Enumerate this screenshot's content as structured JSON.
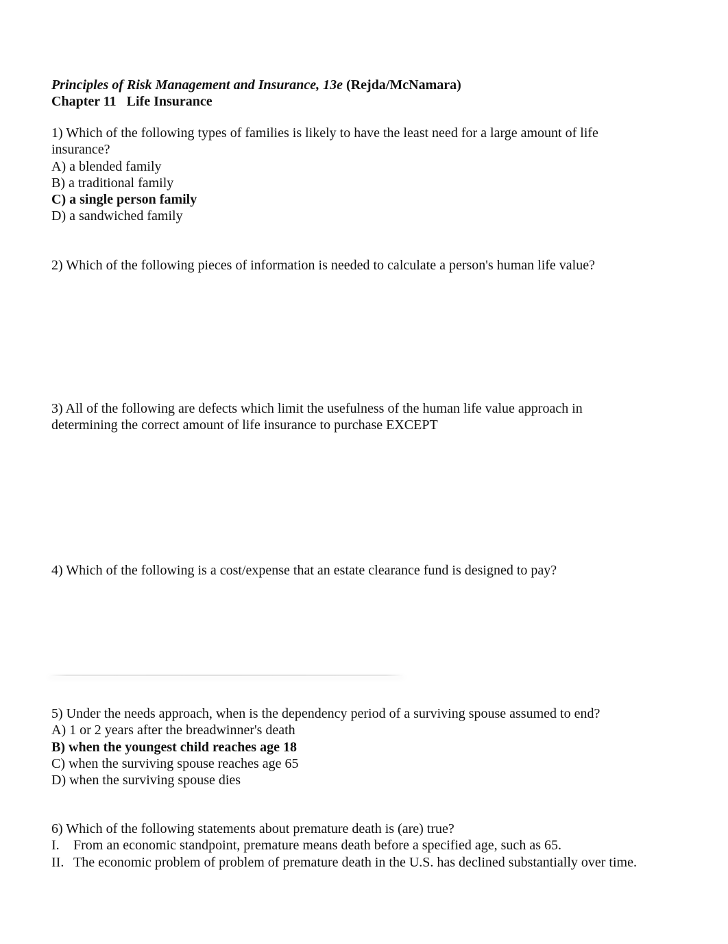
{
  "header": {
    "book_title": "Principles of Risk Management and Insurance, 13e",
    "authors": "(Rejda/McNamara)",
    "chapter": "Chapter 11   Life Insurance"
  },
  "questions": [
    {
      "text": "1) Which of the following types of families is likely to have the least need for a large amount of life insurance?",
      "options": [
        {
          "label": "A) a blended family",
          "correct": false
        },
        {
          "label": "B) a traditional family",
          "correct": false
        },
        {
          "label": "C) a single person family",
          "correct": true
        },
        {
          "label": "D) a sandwiched family",
          "correct": false
        }
      ]
    },
    {
      "text": "2) Which of the following pieces of information is needed to calculate a person's human life value?"
    },
    {
      "text": "3) All of the following are defects which limit the usefulness of the human life value approach in determining the correct amount of life insurance to purchase EXCEPT"
    },
    {
      "text": "4) Which of the following is a cost/expense that an estate clearance fund is designed to pay?"
    },
    {
      "text": "5) Under the needs approach, when is the dependency period of a surviving spouse assumed to end?",
      "options": [
        {
          "label": "A) 1 or 2 years after the breadwinner's death",
          "correct": false
        },
        {
          "label": "B) when the youngest child reaches age 18",
          "correct": true
        },
        {
          "label": "C) when the surviving spouse reaches age 65",
          "correct": false
        },
        {
          "label": "D) when the surviving spouse dies",
          "correct": false
        }
      ]
    },
    {
      "text": "6) Which of the following statements about premature death is (are) true?",
      "statements": [
        {
          "num": "I.",
          "text": "From an economic standpoint, premature means death before a specified age, such as 65."
        },
        {
          "num": "II.",
          "text": "The economic problem of problem of premature death in the U.S. has declined substantially over time."
        }
      ]
    }
  ]
}
